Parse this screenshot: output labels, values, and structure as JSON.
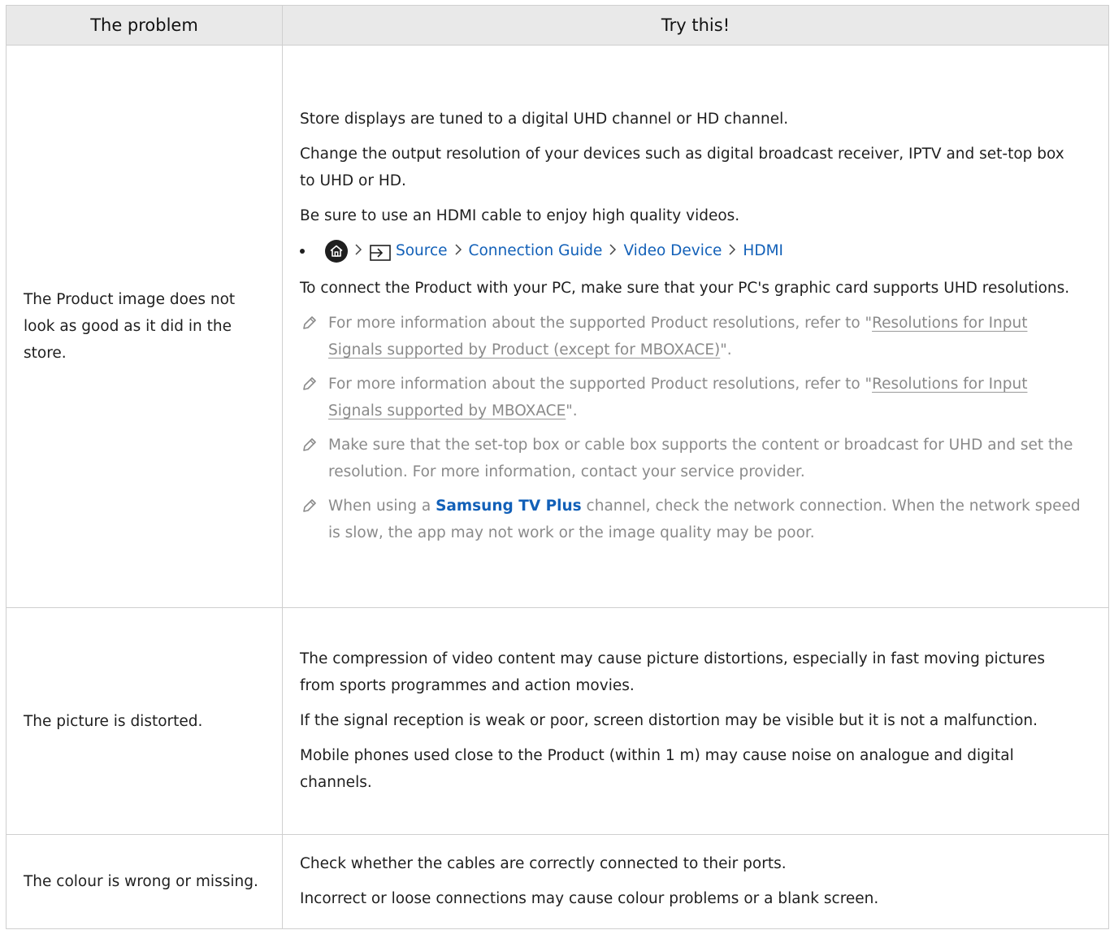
{
  "table": {
    "header_problem": "The problem",
    "header_try": "Try this!"
  },
  "rows": [
    {
      "problem": "The Product image does not look as good as it did in the store.",
      "p1": "Store displays are tuned to a digital UHD channel or HD channel.",
      "p2": "Change the output resolution of your devices such as digital broadcast receiver, IPTV and set-top box to UHD or HD.",
      "p3": "Be sure to use an HDMI cable to enjoy high quality videos.",
      "path": {
        "home_icon": "home-icon",
        "source_icon": "source-input-icon",
        "source": "Source",
        "guide": "Connection Guide",
        "device": "Video Device",
        "hdmi": "HDMI"
      },
      "p4": "To connect the Product with your PC, make sure that your PC's graphic card supports UHD resolutions.",
      "note1_pre": "For more information about the supported Product resolutions, refer to \"",
      "note1_link": "Resolutions for Input Signals supported by Product (except for MBOXACE)",
      "note1_post": "\".",
      "note2_pre": "For more information about the supported Product resolutions, refer to \"",
      "note2_link": "Resolutions for Input Signals supported by MBOXACE",
      "note2_post": "\".",
      "note3": "Make sure that the set-top box or cable box supports the content or broadcast for UHD and set the resolution. For more information, contact your service provider.",
      "note4_pre": "When using a ",
      "note4_link": "Samsung TV Plus",
      "note4_post": " channel, check the network connection. When the network speed is slow, the app may not work or the image quality may be poor."
    },
    {
      "problem": "The picture is distorted.",
      "p1": "The compression of video content may cause picture distortions, especially in fast moving pictures from sports programmes and action movies.",
      "p2": "If the signal reception is weak or poor, screen distortion may be visible but it is not a malfunction.",
      "p3": "Mobile phones used close to the Product (within 1 m) may cause noise on analogue and digital channels."
    },
    {
      "problem": "The colour is wrong or missing.",
      "p1": "Check whether the cables are correctly connected to their ports.",
      "p2": "Incorrect or loose connections may cause colour problems or a blank screen."
    }
  ],
  "colors": {
    "header_bg": "#e9e9e9",
    "border": "#cfcfcf",
    "link": "#1260b8",
    "note_text": "#8a8a8a"
  }
}
